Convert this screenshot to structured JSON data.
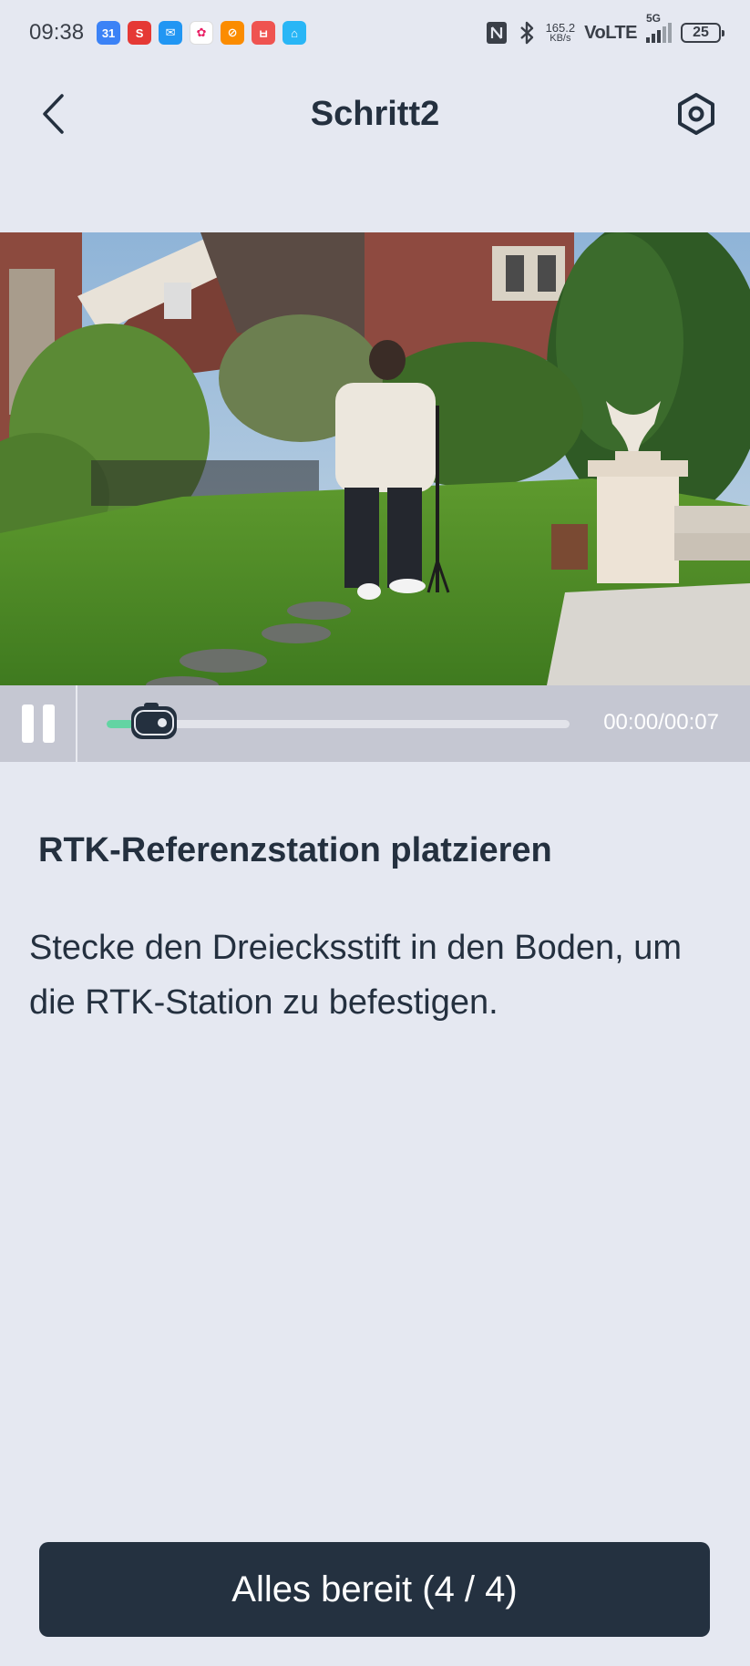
{
  "status_bar": {
    "time": "09:38",
    "apps": [
      {
        "icon": "calendar-app-icon",
        "label": "31",
        "color": "#3b82f6"
      },
      {
        "icon": "s-app-icon",
        "label": "S",
        "color": "#e53935"
      },
      {
        "icon": "mail-app-icon",
        "label": "✉",
        "color": "#2196f3"
      },
      {
        "icon": "photos-app-icon",
        "label": "✿",
        "color": "#fbc02d"
      },
      {
        "icon": "orange-app-icon",
        "label": "⊘",
        "color": "#fb8c00"
      },
      {
        "icon": "red-app-icon",
        "label": "ㅂ",
        "color": "#ef5350"
      },
      {
        "icon": "home-app-icon",
        "label": "⌂",
        "color": "#29b6f6"
      }
    ],
    "speed_value": "165.2",
    "speed_unit": "KB/s",
    "network": "VoLTE",
    "network_gen": "5G",
    "battery": "25"
  },
  "header": {
    "title": "Schritt2"
  },
  "video": {
    "time": "00:00/00:07",
    "progress": 0.0
  },
  "content": {
    "title": "RTK-Referenzstation platzieren",
    "description": "Stecke den Dreiecksstift in den Boden, um die RTK-Station zu befestigen."
  },
  "footer": {
    "button_label": "Alles bereit (4 / 4)"
  },
  "colors": {
    "background": "#e5e8f1",
    "primary": "#243140",
    "accent": "#63d4a3"
  }
}
